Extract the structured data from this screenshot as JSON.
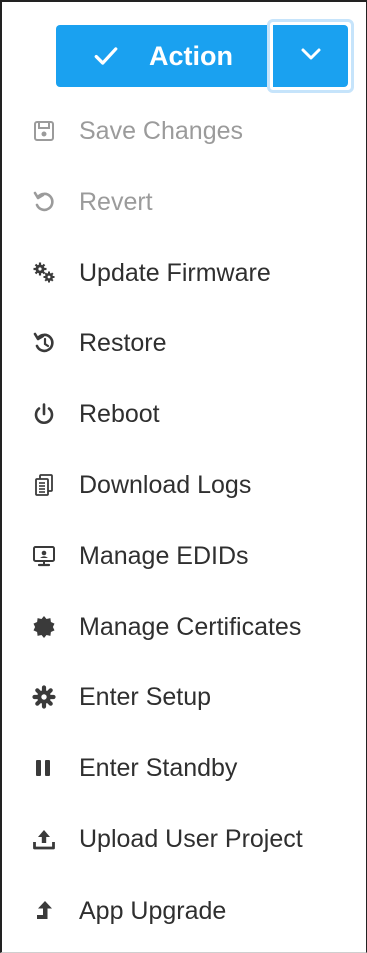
{
  "action": {
    "label": "Action",
    "check_icon": "check-icon",
    "toggle_icon": "chevron-down-icon",
    "accent_color": "#1aa1f0"
  },
  "menu": {
    "items": [
      {
        "label": "Save Changes",
        "icon": "save-icon",
        "disabled": true
      },
      {
        "label": "Revert",
        "icon": "undo-icon",
        "disabled": true
      },
      {
        "label": "Update Firmware",
        "icon": "gears-icon",
        "disabled": false
      },
      {
        "label": "Restore",
        "icon": "history-icon",
        "disabled": false
      },
      {
        "label": "Reboot",
        "icon": "power-icon",
        "disabled": false
      },
      {
        "label": "Download Logs",
        "icon": "logs-icon",
        "disabled": false
      },
      {
        "label": "Manage EDIDs",
        "icon": "monitor-icon",
        "disabled": false
      },
      {
        "label": "Manage Certificates",
        "icon": "certificate-icon",
        "disabled": false
      },
      {
        "label": "Enter Setup",
        "icon": "gear-icon",
        "disabled": false
      },
      {
        "label": "Enter Standby",
        "icon": "pause-icon",
        "disabled": false
      },
      {
        "label": "Upload User Project",
        "icon": "upload-icon",
        "disabled": false
      },
      {
        "label": "App Upgrade",
        "icon": "upgrade-arrow-icon",
        "disabled": false
      }
    ]
  }
}
